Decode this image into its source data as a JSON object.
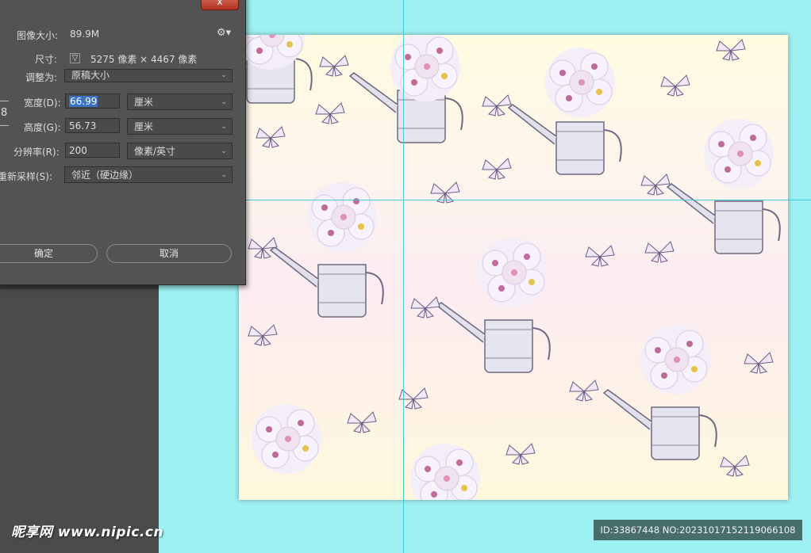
{
  "dialog": {
    "image_size_label": "图像大小:",
    "image_size_value": "89.9M",
    "dimensions_label": "尺寸:",
    "dimensions_value": "5275 像素  ×  4467 像素",
    "fit_to_label": "调整为:",
    "fit_to_value": "原稿大小",
    "width_label": "宽度(D):",
    "width_value": "66.99",
    "width_unit": "厘米",
    "height_label": "高度(G):",
    "height_value": "56.73",
    "height_unit": "厘米",
    "resolution_label": "分辨率(R):",
    "resolution_value": "200",
    "resolution_unit": "像素/英寸",
    "resample_label": "重新采样(S):",
    "resample_value": "邻近（硬边缘）",
    "ok_label": "确定",
    "cancel_label": "取消",
    "close_label": "x",
    "link_glyph": "8"
  },
  "watermark": {
    "left": "昵享网 www.nipic.cn",
    "right": "ID:33867448 NO:20231017152119066108"
  },
  "colors": {
    "background": "#9ef1f2",
    "panel": "#535353",
    "accent_selection": "#3a73c5",
    "guide": "#39c6d1"
  },
  "icons": [
    "gear-icon",
    "chevron-down-icon",
    "checkbox-icon",
    "link-icon",
    "close-icon",
    "watering-can-icon",
    "butterfly-icon",
    "flower-bouquet-icon"
  ]
}
